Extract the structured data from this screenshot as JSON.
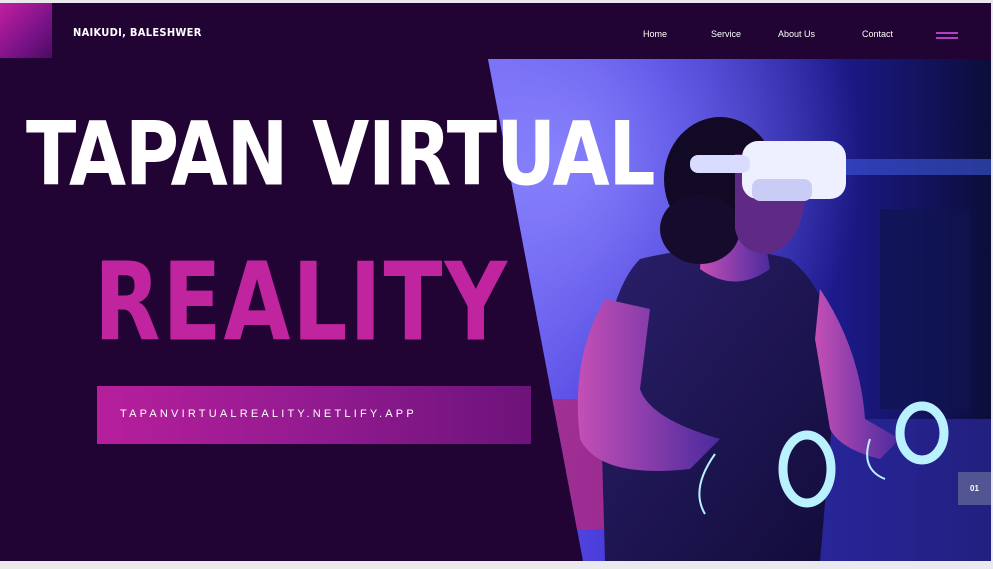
{
  "header": {
    "brand": "NAIKUDI, BALESHWER",
    "nav": [
      {
        "label": "Home"
      },
      {
        "label": "Service"
      },
      {
        "label": "About Us"
      },
      {
        "label": "Contact"
      }
    ]
  },
  "hero": {
    "title_line1": "TAPAN VIRTUAL",
    "title_line2": "REALITY",
    "url_text": "TAPANVIRTUALREALITY.NETLIFY.APP",
    "slide_number": "01"
  },
  "colors": {
    "background": "#210434",
    "accent": "#c1249f",
    "nav_menu_icon": "#b33fc4",
    "text": "#ffffff"
  },
  "icons": {
    "menu": "hamburger-menu-icon"
  }
}
